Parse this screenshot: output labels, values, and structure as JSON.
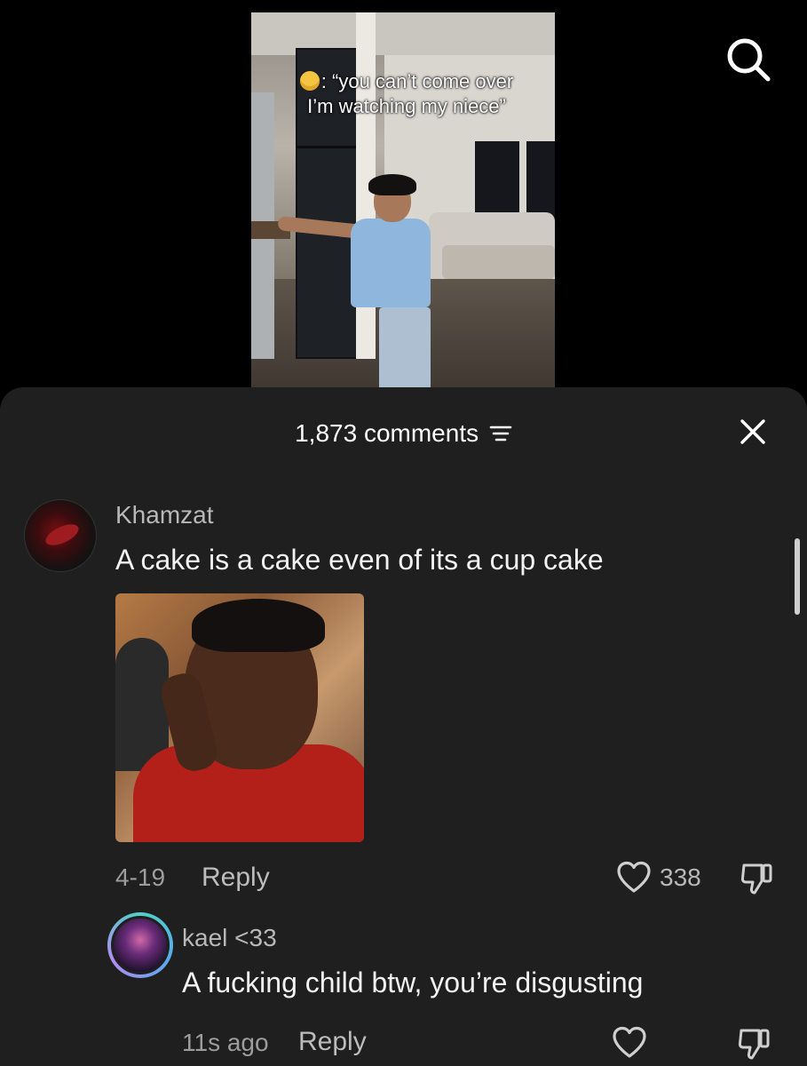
{
  "video": {
    "caption_line1": ": “you can’t come over",
    "caption_line2": "I’m watching my niece”"
  },
  "sheet": {
    "comment_count": "1,873 comments"
  },
  "comments": [
    {
      "username": "Khamzat",
      "text": "A cake is a cake even of its a cup cake",
      "date": "4-19",
      "reply_label": "Reply",
      "likes": "338"
    },
    {
      "username": "kael <33",
      "text": "A fucking child btw, you’re disgusting",
      "date": "11s ago",
      "reply_label": "Reply"
    }
  ],
  "colors": {
    "background": "#000000",
    "sheet": "#1f1f1f",
    "meta_text": "#9d9d9d"
  },
  "icons": [
    "search-icon",
    "filter-icon",
    "close-icon",
    "heart-icon",
    "dislike-icon"
  ]
}
